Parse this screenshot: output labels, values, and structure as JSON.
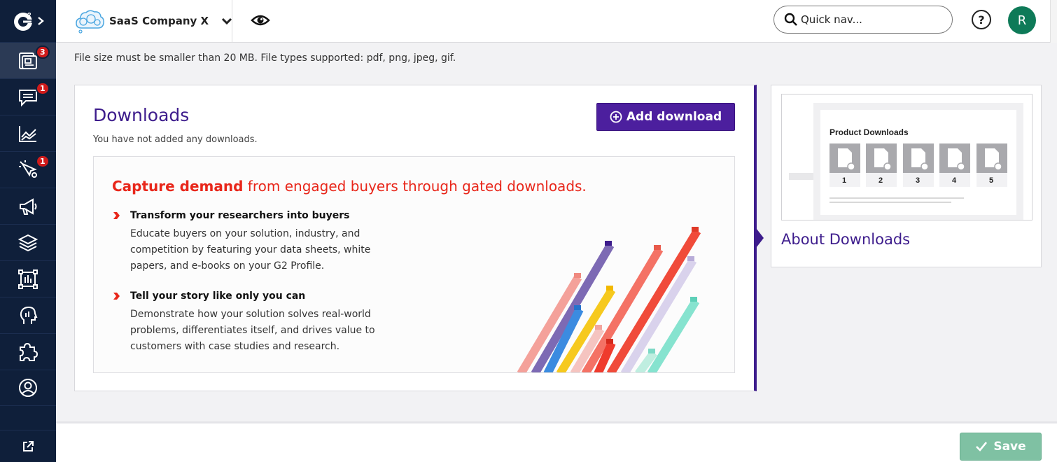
{
  "sidebar": {
    "logo_text": "2",
    "items": [
      {
        "icon": "profile-pages-icon",
        "badge": "3"
      },
      {
        "icon": "chat-icon",
        "badge": "1"
      },
      {
        "icon": "chart-icon",
        "badge": ""
      },
      {
        "icon": "click-location-icon",
        "badge": "1"
      },
      {
        "icon": "megaphone-icon",
        "badge": ""
      },
      {
        "icon": "layers-icon",
        "badge": ""
      },
      {
        "icon": "report-icon",
        "badge": ""
      },
      {
        "icon": "head-insights-icon",
        "badge": ""
      },
      {
        "icon": "puzzle-icon",
        "badge": ""
      },
      {
        "icon": "user-circle-icon",
        "badge": ""
      }
    ],
    "bottom_icon": "external-link-icon"
  },
  "header": {
    "company_name": "SaaS Company X",
    "quick_nav_placeholder": "Quick nav...",
    "help_label": "?",
    "avatar_initial": "R"
  },
  "notice": "File size must be smaller than 20 MB. File types supported: pdf, png, jpeg, gif.",
  "downloads": {
    "title": "Downloads",
    "subtitle": "You have not added any downloads.",
    "add_button": "Add download",
    "promo": {
      "headline_bold": "Capture demand",
      "headline_rest": " from engaged buyers through gated downloads.",
      "features": [
        {
          "title": "Transform your researchers into buyers",
          "body": "Educate buyers on your solution, industry, and competition by featuring your data sheets, white papers, and e-books on your G2 Profile."
        },
        {
          "title": "Tell your story like only you can",
          "body": "Demonstrate how your solution solves real-world problems, differentiates itself, and drives value to customers with case studies and research."
        }
      ]
    }
  },
  "about": {
    "title": "About Downloads",
    "thumb_title": "Product Downloads",
    "thumb_items": [
      "1",
      "2",
      "3",
      "4",
      "5"
    ]
  },
  "footer": {
    "save_label": "Save"
  },
  "colors": {
    "sidebar": "#0f1f3a",
    "brand_purple": "#4c1f9e",
    "accent_red": "#e8261a",
    "save_green": "#7fc1a3",
    "badge_red": "#d01b1b",
    "avatar_green": "#0e7a58"
  }
}
